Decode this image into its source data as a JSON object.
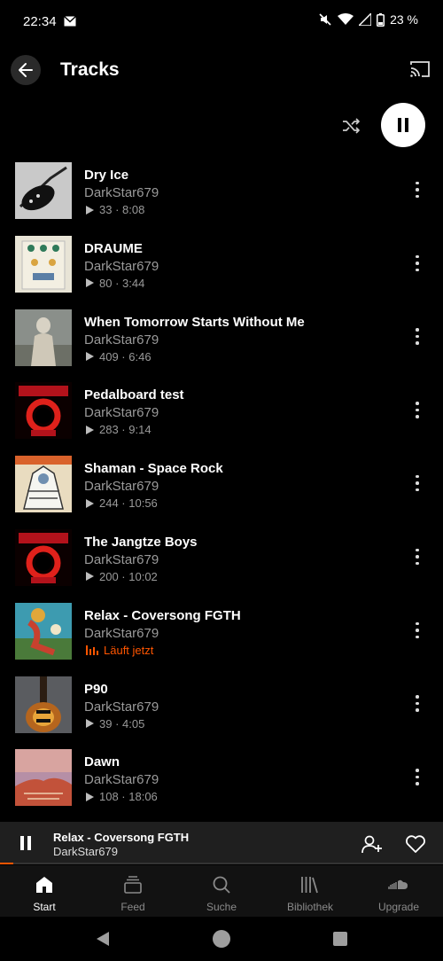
{
  "status_bar": {
    "time": "22:34",
    "battery": "23 %"
  },
  "header": {
    "title": "Tracks"
  },
  "tracks": [
    {
      "title": "Dry Ice",
      "artist": "DarkStar679",
      "meta": "33 · 8:08",
      "art": "guitar-black"
    },
    {
      "title": "DRAUME",
      "artist": "DarkStar679",
      "meta": "80 · 3:44",
      "art": "pedal"
    },
    {
      "title": "When Tomorrow Starts Without Me",
      "artist": "DarkStar679",
      "meta": "409 · 6:46",
      "art": "statue"
    },
    {
      "title": "Pedalboard test",
      "artist": "DarkStar679",
      "meta": "283 · 9:14",
      "art": "darkstar"
    },
    {
      "title": "Shaman - Space Rock",
      "artist": "DarkStar679",
      "meta": "244 · 10:56",
      "art": "shaman"
    },
    {
      "title": "The Jangtze Boys",
      "artist": "DarkStar679",
      "meta": "200 · 10:02",
      "art": "darkstar"
    },
    {
      "title": "Relax - Coversong FGTH",
      "artist": "DarkStar679",
      "meta": "Läuft jetzt",
      "art": "relax",
      "now_playing": true
    },
    {
      "title": "P90",
      "artist": "DarkStar679",
      "meta": "39 · 4:05",
      "art": "guitar-sunburst"
    },
    {
      "title": "Dawn",
      "artist": "DarkStar679",
      "meta": "108 · 18:06",
      "art": "dawn"
    }
  ],
  "mini_player": {
    "title": "Relax - Coversong FGTH",
    "artist": "DarkStar679",
    "progress": 0.03
  },
  "bottom_nav": [
    {
      "label": "Start",
      "icon": "home-icon",
      "active": true
    },
    {
      "label": "Feed",
      "icon": "feed-icon"
    },
    {
      "label": "Suche",
      "icon": "search-icon"
    },
    {
      "label": "Bibliothek",
      "icon": "library-icon"
    },
    {
      "label": "Upgrade",
      "icon": "soundcloud-icon"
    }
  ],
  "colors": {
    "accent": "#ff5500",
    "background": "#000000",
    "mini_player_bg": "#1f1f1f"
  }
}
